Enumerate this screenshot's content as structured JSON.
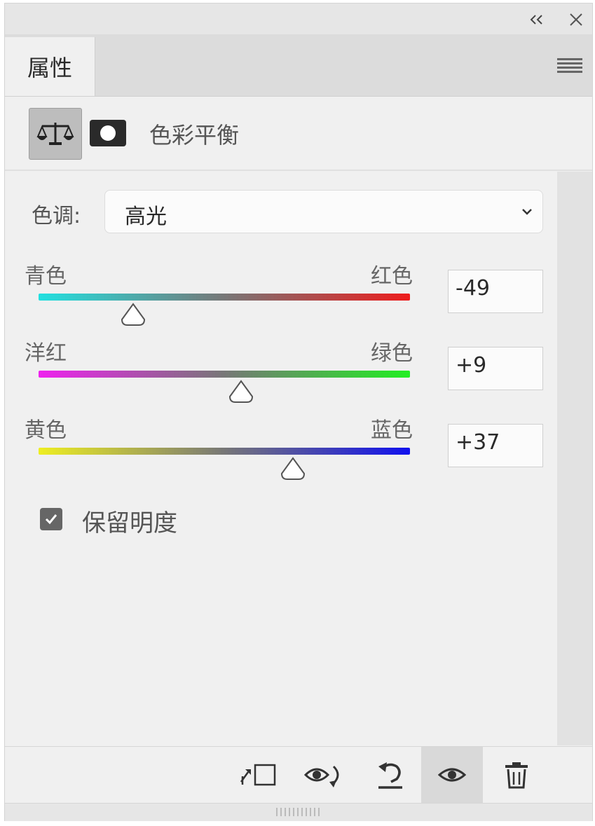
{
  "panel": {
    "tab_label": "属性",
    "adjustment_title": "色彩平衡",
    "icons": {
      "collapse": "double-chevron-left-icon",
      "close": "close-icon",
      "menu": "hamburger-menu-icon",
      "adjustment": "balance-scale-icon",
      "mask": "mask-icon"
    }
  },
  "tone": {
    "label": "色调:",
    "selected": "高光"
  },
  "sliders": [
    {
      "left_label": "青色",
      "right_label": "红色",
      "value": "-49",
      "gradient": [
        "#22e0e0",
        "#ee1c1c"
      ]
    },
    {
      "left_label": "洋红",
      "right_label": "绿色",
      "value": "+9",
      "gradient": [
        "#ee22ee",
        "#22ee22"
      ]
    },
    {
      "left_label": "黄色",
      "right_label": "蓝色",
      "value": "+37",
      "gradient": [
        "#eeee22",
        "#1111ee"
      ]
    }
  ],
  "preserve_luminosity": {
    "label": "保留明度",
    "checked": true
  },
  "footer": {
    "icons": [
      "clip-to-layer-icon",
      "view-previous-state-icon",
      "reset-icon",
      "visibility-eye-icon",
      "delete-trash-icon"
    ]
  }
}
